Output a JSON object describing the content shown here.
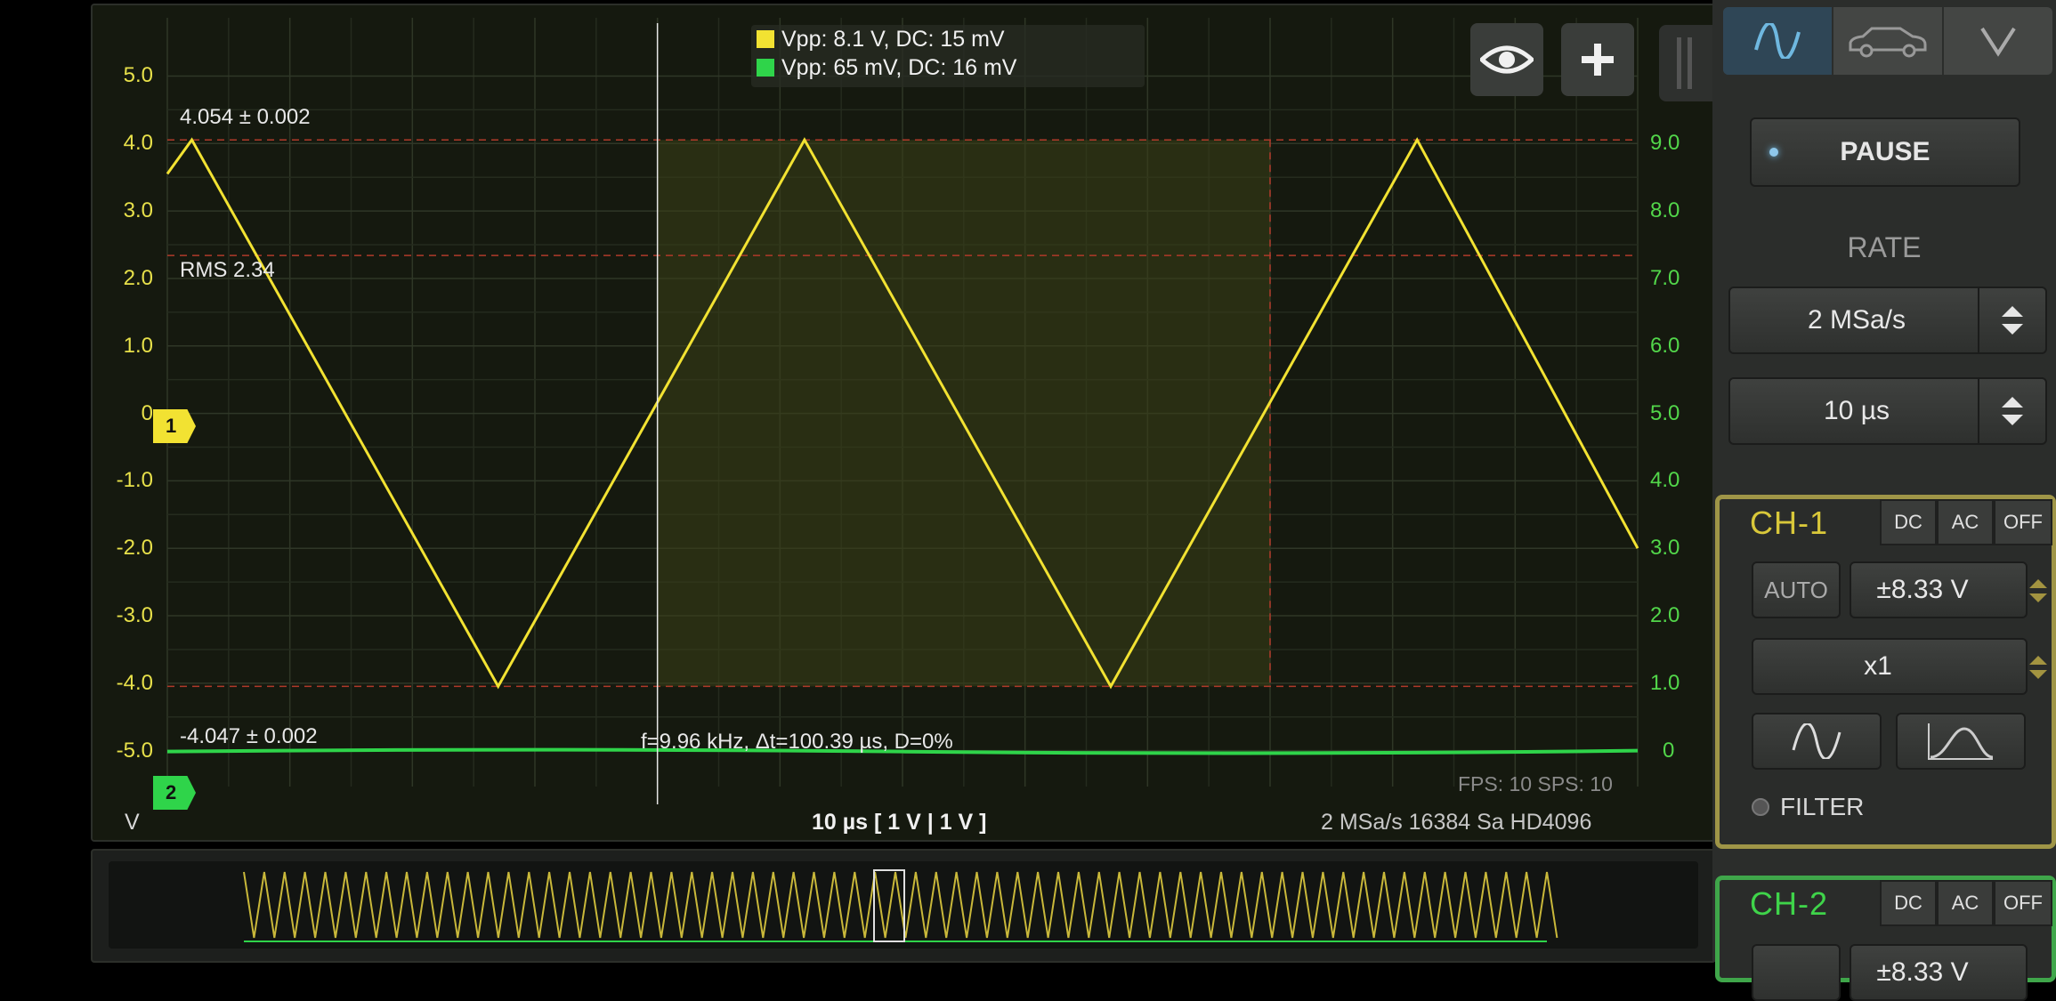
{
  "colors": {
    "ch1": "#f2e232",
    "ch2": "#2fd44a",
    "accent": "#6fb8e0",
    "ch1_panel_border": "#9f9547",
    "ch2_panel_border": "#3fa64a"
  },
  "left_axis": {
    "unit": "V",
    "ticks": [
      "5.0",
      "4.0",
      "3.0",
      "2.0",
      "1.0",
      "0",
      "-1.0",
      "-2.0",
      "-3.0",
      "-4.0",
      "-5.0"
    ]
  },
  "right_axis": {
    "ticks": [
      "9.0",
      "8.0",
      "7.0",
      "6.0",
      "5.0",
      "4.0",
      "3.0",
      "2.0",
      "1.0",
      "0"
    ]
  },
  "legend": [
    {
      "text": "Vpp: 8.1 V, DC: 15 mV",
      "color": "#f2e232"
    },
    {
      "text": "Vpp: 65 mV, DC: 16 mV",
      "color": "#2fd44a"
    }
  ],
  "measurements": {
    "max": "4.054 ± 0.002",
    "rms": "RMS 2.34",
    "min": "-4.047 ± 0.002",
    "cursor": "f=9.96 kHz, Δt=100.39 µs, D=0%"
  },
  "markers": {
    "ch1": "1",
    "ch2": "2"
  },
  "icons": {
    "eye": "eye-icon",
    "add": "plus-icon"
  },
  "status": {
    "timebase": "10 µs  [ 1 V | 1 V ]",
    "rate_info": "2 MSa/s   16384 Sa   HD4096",
    "fps": "FPS: 10  SPS: 10"
  },
  "panel": {
    "tabs": [
      {
        "icon": "sine-wave-icon"
      },
      {
        "icon": "car-icon"
      },
      {
        "icon": "chevron-down-icon"
      }
    ],
    "pause_label": "PAUSE",
    "rate_label": "RATE",
    "rate_value": "2 MSa/s",
    "time_value": "10 µs",
    "ch1": {
      "title": "CH-1",
      "modes": [
        "DC",
        "AC",
        "OFF"
      ],
      "auto": "AUTO",
      "range": "±8.33 V",
      "probe": "x1",
      "filter": "FILTER"
    },
    "ch2": {
      "title": "CH-2",
      "modes": [
        "DC",
        "AC",
        "OFF"
      ],
      "range": "±8.33 V"
    }
  },
  "chart_data": {
    "type": "line",
    "x_divisions": 12,
    "series": [
      {
        "color": "#f2e232",
        "triangle_wave": {
          "amplitude_V": 4.05,
          "period_div": 10.04,
          "points": [
            [
              0,
              3.55
            ],
            [
              0.2,
              4.054
            ],
            [
              2.7,
              -4.047
            ],
            [
              5.2,
              4.054
            ],
            [
              7.7,
              -4.047
            ],
            [
              10.2,
              4.054
            ],
            [
              12,
              -2.0
            ]
          ]
        }
      },
      {
        "color": "#2fd44a",
        "flat_V": -5.0
      }
    ],
    "ylim": [
      -5.4,
      5.6
    ],
    "cursor_region_div": [
      4.0,
      9.0
    ],
    "rms_line_V": 2.34
  }
}
